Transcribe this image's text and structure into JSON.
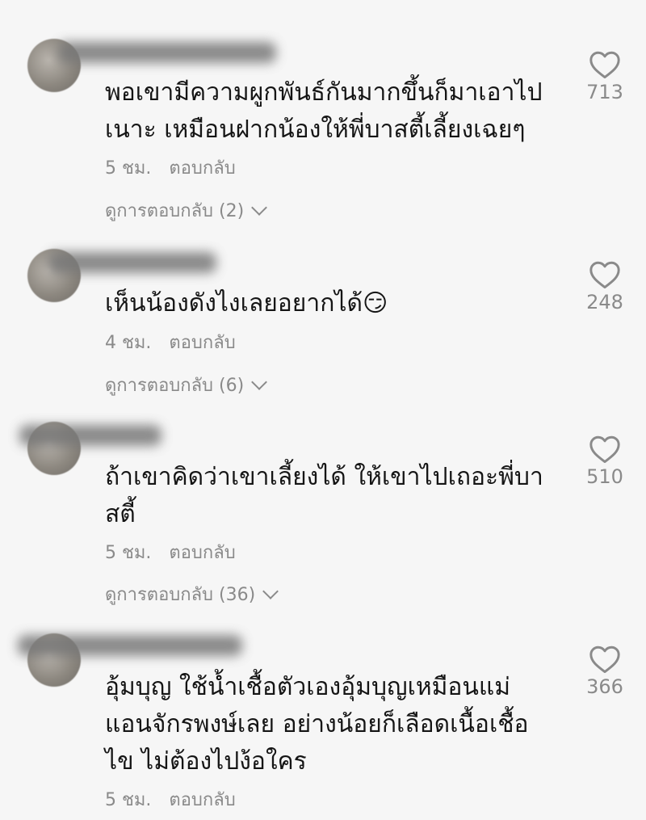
{
  "comments": [
    {
      "text": "พอเขามีความผูกพันธ์กันมากขึ้นก็มาเอาไป\nเนาะ เหมือนฝากน้องให้พี่บาสตี้เลี้ยงเฉยๆ",
      "time": "5 ชม.",
      "reply_label": "ตอบกลับ",
      "view_replies": "ดูการตอบกลับ (2)",
      "likes": "713"
    },
    {
      "text": "เห็นน้องดังไงเลยอยากได้😏",
      "time": "4 ชม.",
      "reply_label": "ตอบกลับ",
      "view_replies": "ดูการตอบกลับ (6)",
      "likes": "248"
    },
    {
      "text": "ถ้าเขาคิดว่าเขาเลี้ยงได้ ให้เขาไปเถอะพี่บา\nสตี้",
      "time": "5 ชม.",
      "reply_label": "ตอบกลับ",
      "view_replies": "ดูการตอบกลับ (36)",
      "likes": "510"
    },
    {
      "text": "อุ้มบุญ ใช้น้ำเชื้อตัวเองอุ้มบุญเหมือนแม่\nแอนจักรพงษ์เลย อย่างน้อยก็เลือดเนื้อเชื้อ\nไข ไม่ต้องไปง้อใคร",
      "time": "5 ชม.",
      "reply_label": "ตอบกลับ",
      "likes": "366"
    }
  ],
  "colors": {
    "background": "#f6f6f6",
    "text": "#151515",
    "secondary": "#8a8a8a"
  },
  "icons": {
    "like": "heart-outline-icon",
    "expand": "chevron-down-icon"
  }
}
